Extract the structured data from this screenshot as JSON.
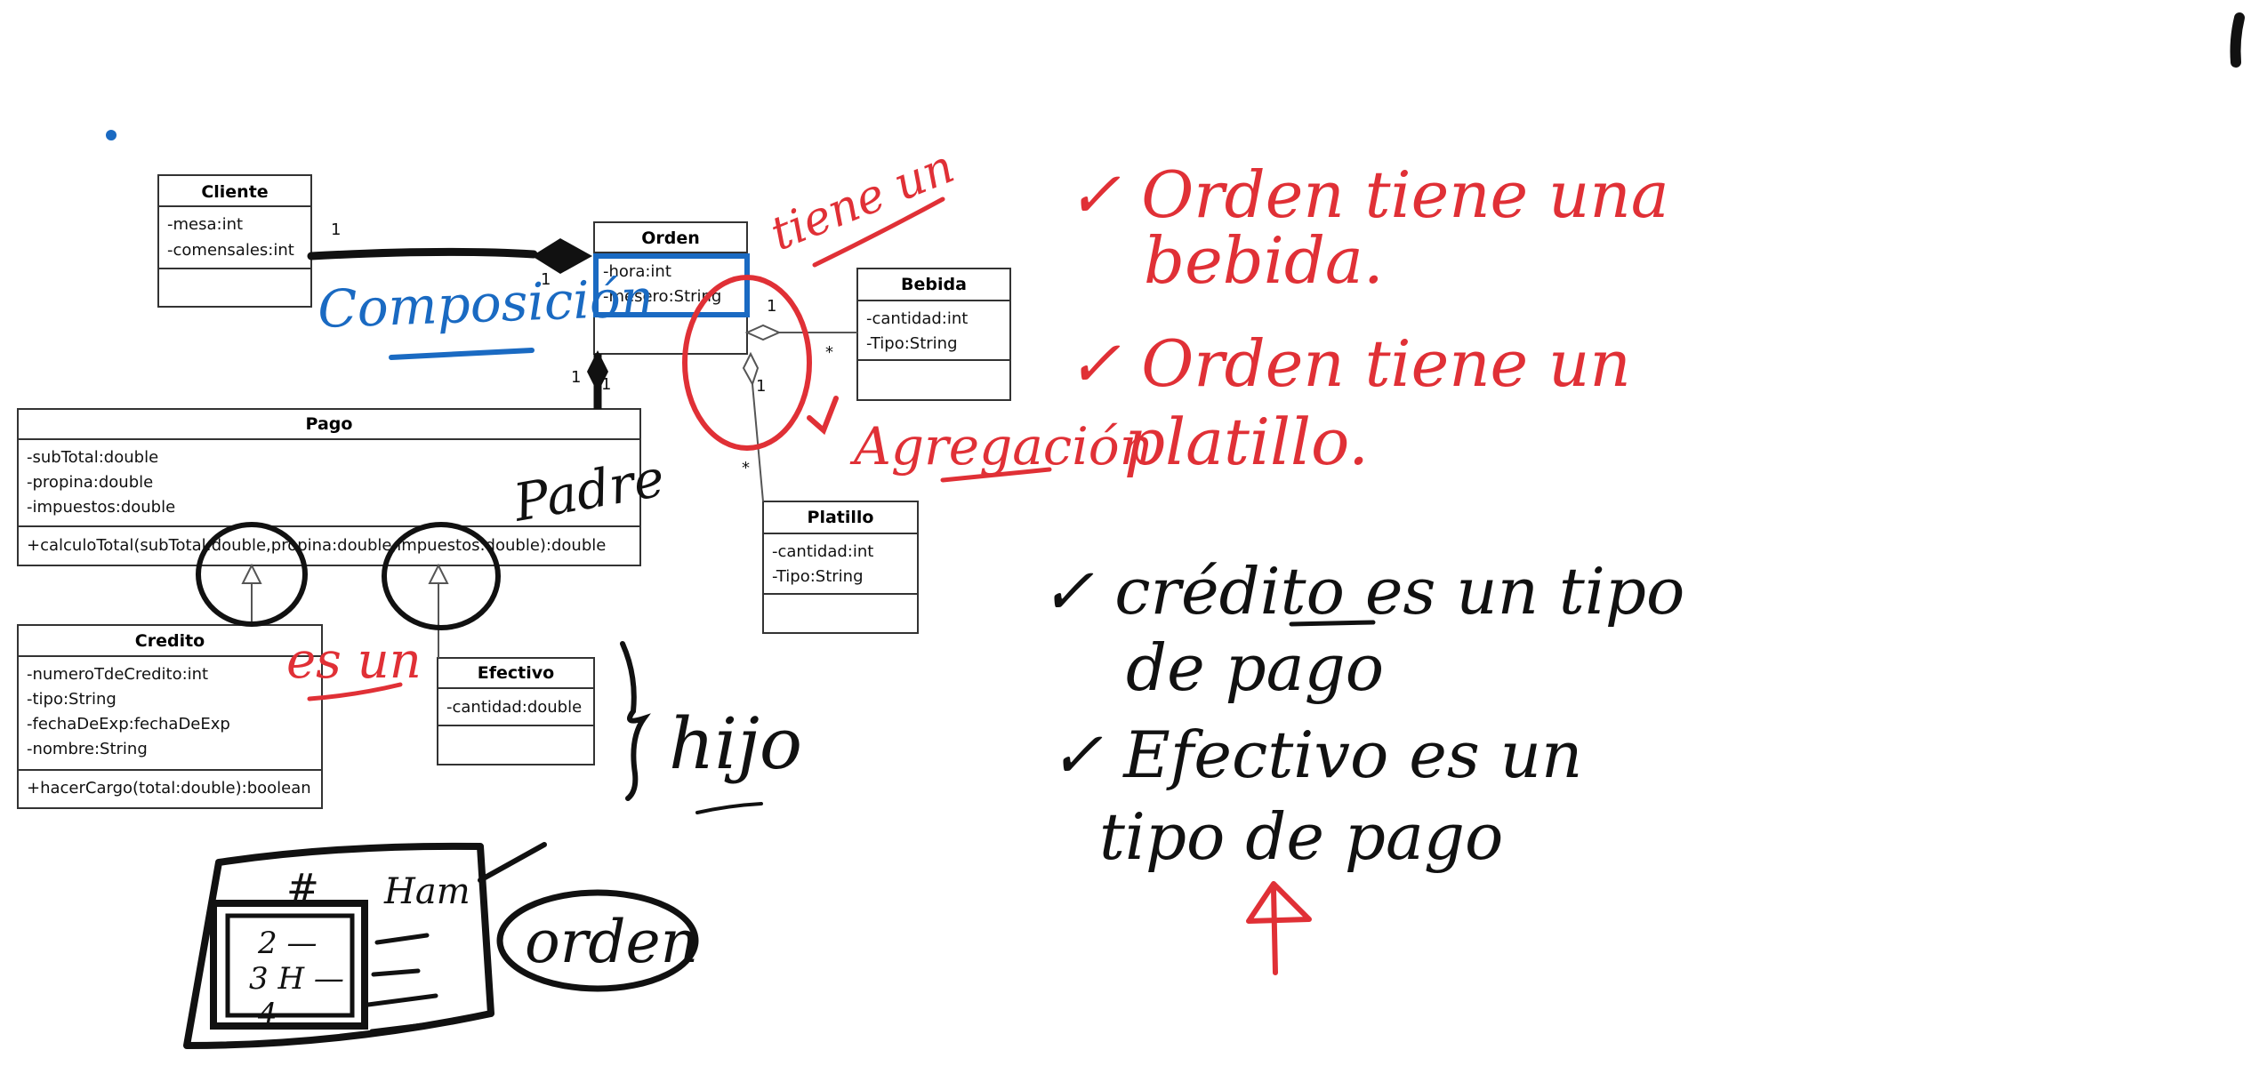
{
  "classes": {
    "cliente": {
      "name": "Cliente",
      "attributes": [
        "-mesa:int",
        "-comensales:int"
      ],
      "methods": []
    },
    "orden": {
      "name": "Orden",
      "attributes": [
        "-hora:int",
        "-mesero:String"
      ],
      "methods": []
    },
    "bebida": {
      "name": "Bebida",
      "attributes": [
        "-cantidad:int",
        "-Tipo:String"
      ],
      "methods": []
    },
    "platillo": {
      "name": "Platillo",
      "attributes": [
        "-cantidad:int",
        "-Tipo:String"
      ],
      "methods": []
    },
    "pago": {
      "name": "Pago",
      "attributes": [
        "-subTotal:double",
        "-propina:double",
        "-impuestos:double"
      ],
      "methods": [
        "+calculoTotal(subTotal:double,propina:double,impuestos:double):double"
      ]
    },
    "credito": {
      "name": "Credito",
      "attributes": [
        "-numeroTdeCredito:int",
        "-tipo:String",
        "-fechaDeExp:fechaDeExp",
        "-nombre:String"
      ],
      "methods": [
        "+hacerCargo(total:double):boolean"
      ]
    },
    "efectivo": {
      "name": "Efectivo",
      "attributes": [
        "-cantidad:double"
      ],
      "methods": []
    }
  },
  "multiplicities": {
    "cliente_orden_left": "1",
    "cliente_orden_right": "1",
    "orden_bebida_orden": "1",
    "orden_bebida_bebida": "*",
    "orden_platillo_orden": "1",
    "orden_platillo_platillo": "*",
    "orden_pago_orden": "1",
    "orden_pago_pago": "1"
  },
  "annotations": {
    "composicion": "Composición",
    "tiene_un": "tiene un",
    "agregacion": "Agregación",
    "padre": "Padre",
    "es_un": "es un",
    "hijo": "hijo",
    "orden_tiene_bebida_1": "✓ Orden tiene una",
    "orden_tiene_bebida_2": "bebida.",
    "orden_tiene_platillo_1": "✓ Orden tiene un",
    "orden_tiene_platillo_2": "platillo.",
    "credito_es_1": "✓ crédito es un tipo",
    "credito_es_2": "de pago",
    "efectivo_es_1": "✓ Efectivo es un",
    "efectivo_es_2": "tipo de pago",
    "ticket_hash": "#",
    "ticket_lines": [
      "2 —",
      "3 H —",
      "4 —"
    ],
    "ticket_label": "orden",
    "sketch_label": "Ham"
  },
  "colors": {
    "ink_red": "#e03036",
    "ink_blue": "#1a6ac2",
    "ink_black": "#111111"
  }
}
